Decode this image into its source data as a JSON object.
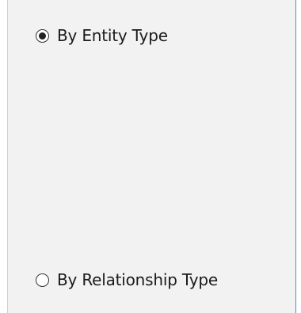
{
  "options": {
    "entity_type": {
      "label": "By Entity Type",
      "selected": true
    },
    "relationship_type": {
      "label": "By Relationship Type",
      "selected": false
    }
  }
}
